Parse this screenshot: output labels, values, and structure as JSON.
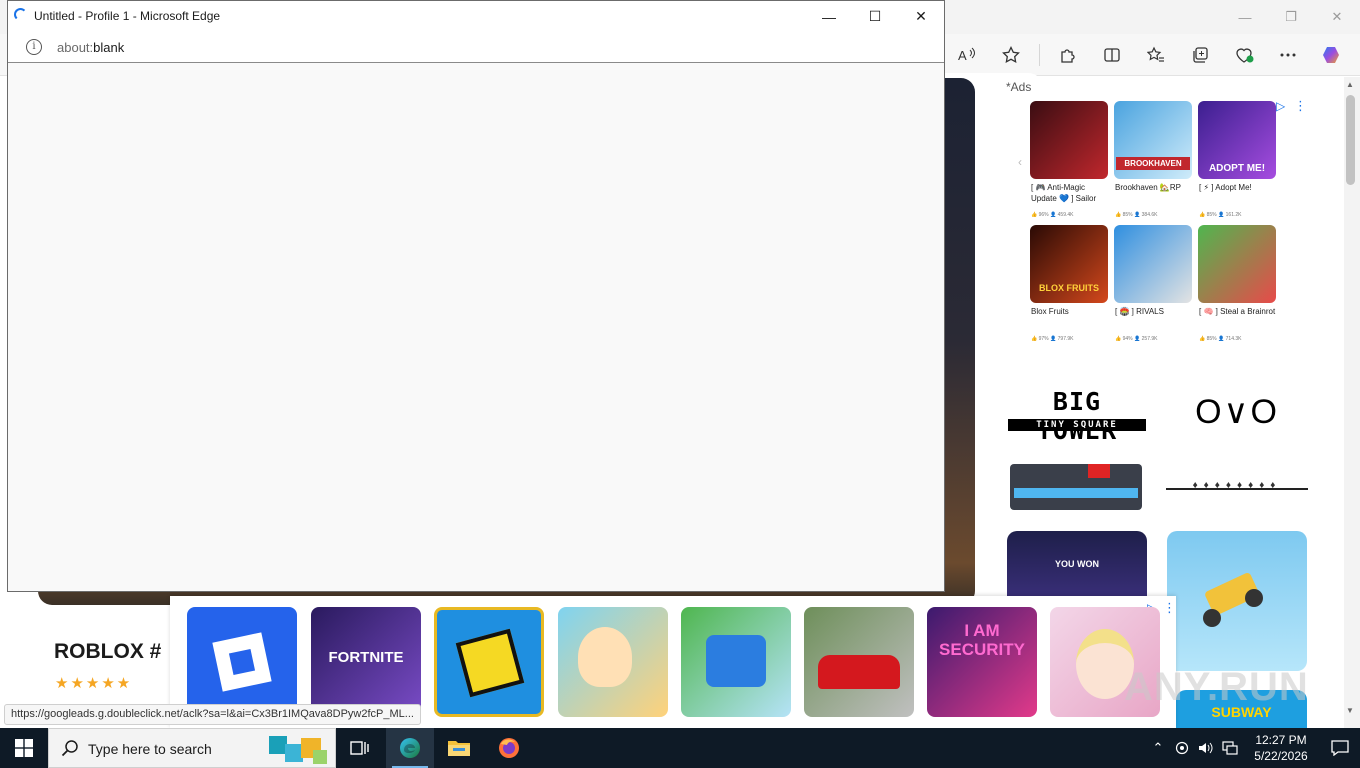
{
  "popup": {
    "title": "Untitled - Profile 1 - Microsoft Edge",
    "url_scheme": "about:",
    "url_host": "blank"
  },
  "content": {
    "heading": "ROBLOX # ",
    "stars": "★★★★★"
  },
  "ads": {
    "label": "*Ads",
    "grid": [
      {
        "caption": "[ 🎮 Anti-Magic Update 💙 ] Sailor",
        "stat": "👍 96%   👤 459.4K",
        "colors": [
          "#3a0d12",
          "#c1272d"
        ]
      },
      {
        "caption": "Brookhaven 🏡RP",
        "stat": "👍 85%   👤 384.6K",
        "colors": [
          "#4aa3df",
          "#d0ecfa"
        ],
        "tile_text": "BROOKHAVEN"
      },
      {
        "caption": "[ ⚡ ] Adopt Me!",
        "stat": "👍 85%   👤 161.2K",
        "colors": [
          "#3b1f8f",
          "#a64de0"
        ],
        "tile_text": "ADOPT ME!"
      },
      {
        "caption": "Blox Fruits",
        "stat": "👍 97%   👤 797.9K",
        "colors": [
          "#2a0a05",
          "#d4481c"
        ],
        "tile_text": "BLOX FRUITS"
      },
      {
        "caption": "[ 🏟️ ] RIVALS",
        "stat": "👍 94%   👤 257.9K",
        "colors": [
          "#2f8fe0",
          "#e3e3e3"
        ]
      },
      {
        "caption": "[ 🧠 ] Steal a Brainrot",
        "stat": "👍 85%   👤 714.3K",
        "colors": [
          "#4fb64f",
          "#e84a4a"
        ]
      }
    ],
    "big_tower_line1": "BIG TOWER",
    "big_tower_line2": "TINY SQUARE",
    "ovo": "O∨O",
    "ovo_pins": "♦♦♦♦♦♦♦♦",
    "you_won": "YOU WON",
    "subway": "SUBWAY"
  },
  "bottom_ads": [
    {
      "name": "roblox",
      "colors": [
        "#2563eb",
        "#2563eb"
      ]
    },
    {
      "name": "fortnite",
      "colors": [
        "#2a1a5e",
        "#7a4cc7"
      ],
      "label": "FORTNITE"
    },
    {
      "name": "geometry-dash",
      "colors": [
        "#1f8fe0",
        "#1f8fe0"
      ]
    },
    {
      "name": "toca-world",
      "colors": [
        "#7fd3f0",
        "#ffd27a"
      ]
    },
    {
      "name": "dog-runner",
      "colors": [
        "#4fb64f",
        "#b5e3f7"
      ]
    },
    {
      "name": "car-racing",
      "colors": [
        "#6e8f5a",
        "#c0c0c0"
      ]
    },
    {
      "name": "i-am-security",
      "colors": [
        "#3b1a6e",
        "#e23a8a"
      ],
      "label": "I AM SECURITY"
    },
    {
      "name": "princess-makeover",
      "colors": [
        "#f3d6e8",
        "#e8a6c6"
      ]
    }
  ],
  "status_url": "https://googleads.g.doubleclick.net/aclk?sa=l&ai=Cx3Br1IMQava8DPyw2fcP_ML...",
  "taskbar": {
    "search_placeholder": "Type here to search",
    "time": "12:27 PM",
    "date": "5/22/2026"
  },
  "watermark": "ANY.RUN"
}
